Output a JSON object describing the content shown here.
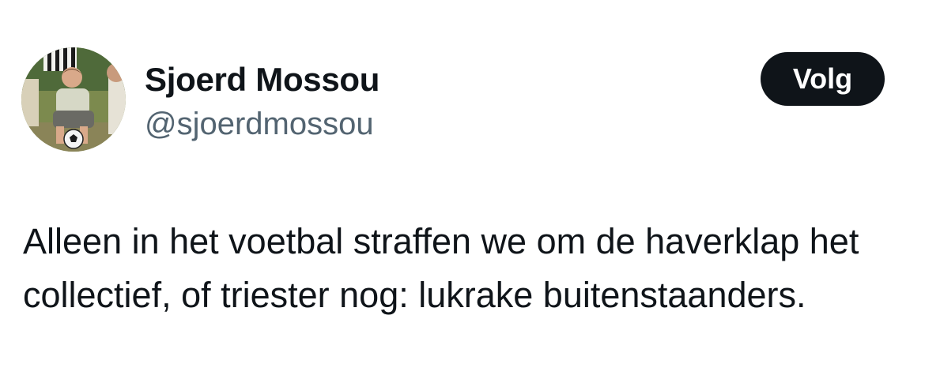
{
  "tweet": {
    "author": {
      "display_name": "Sjoerd Mossou",
      "handle": "@sjoerdmossou",
      "avatar_icon": "avatar-photo"
    },
    "follow_label": "Volg",
    "text": "Alleen in het voetbal straffen we om de haverklap het collectief, of triester nog: lukrake buitenstaanders."
  },
  "colors": {
    "text": "#0f1419",
    "secondary_text": "#536471",
    "button_background": "#0f1419",
    "button_text": "#ffffff",
    "background": "#ffffff"
  }
}
